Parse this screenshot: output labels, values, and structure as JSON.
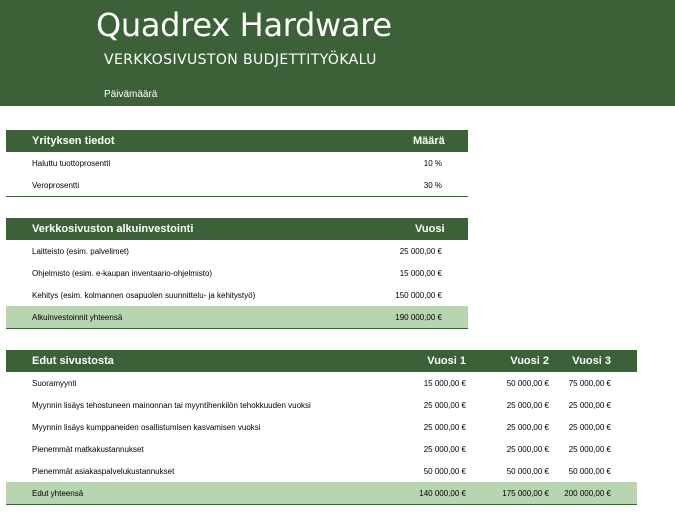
{
  "header": {
    "company": "Quadrex Hardware",
    "subtitle": "VERKKOSIVUSTON BUDJETTITYÖKALU",
    "date_label": "Päivämäärä"
  },
  "company_info": {
    "title": "Yrityksen tiedot",
    "value_header": "Määrä",
    "rows": [
      {
        "label": "Haluttu tuottoprosentti",
        "value": "10 %"
      },
      {
        "label": "Veroprosentti",
        "value": "30 %"
      }
    ]
  },
  "initial_investment": {
    "title": "Verkkosivuston alkuinvestointi",
    "value_header": "Vuosi",
    "rows": [
      {
        "label": "Laitteisto (esim. palvelimet)",
        "value": "25 000,00 €"
      },
      {
        "label": "Ohjelmisto (esim. e-kaupan inventaario-ohjelmisto)",
        "value": "15 000,00 €"
      },
      {
        "label": "Kehitys (esim. kolmannen osapuolen suunnittelu- ja kehitystyö)",
        "value": "150 000,00 €"
      }
    ],
    "total": {
      "label": "Alkuinvestoinnit yhteensä",
      "value": "190 000,00 €"
    }
  },
  "benefits": {
    "title": "Edut sivustosta",
    "year_headers": [
      "Vuosi 1",
      "Vuosi 2",
      "Vuosi 3"
    ],
    "rows": [
      {
        "label": "Suoramyynti",
        "values": [
          "15 000,00 €",
          "50 000,00 €",
          "75 000,00 €"
        ]
      },
      {
        "label": "Myynnin lisäys tehostuneen mainonnan tai myyntihenkilön tehokkuuden vuoksi",
        "values": [
          "25 000,00 €",
          "25 000,00 €",
          "25 000,00 €"
        ]
      },
      {
        "label": "Myynnin lisäys kumppaneiden osallistumisen kasvamisen vuoksi",
        "values": [
          "25 000,00 €",
          "25 000,00 €",
          "25 000,00 €"
        ]
      },
      {
        "label": "Pienemmät matkakustannukset",
        "values": [
          "25 000,00 €",
          "25 000,00 €",
          "25 000,00 €"
        ]
      },
      {
        "label": "Pienemmät asiakaspalvelukustannukset",
        "values": [
          "50 000,00 €",
          "50 000,00 €",
          "50 000,00 €"
        ]
      }
    ],
    "total": {
      "label": "Edut yhteensä",
      "values": [
        "140 000,00 €",
        "175 000,00 €",
        "200 000,00 €"
      ]
    }
  }
}
